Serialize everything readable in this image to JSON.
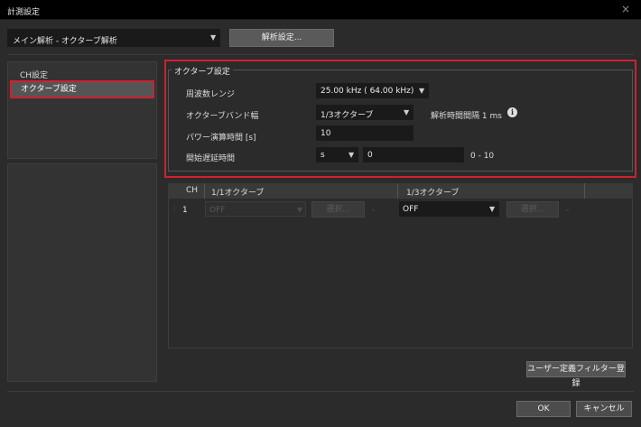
{
  "window": {
    "title": "計測設定",
    "close_glyph": "×"
  },
  "mode": {
    "selected": "メイン解析 - オクターブ解析",
    "analysis_button": "解析設定..."
  },
  "nav": {
    "items": [
      {
        "label": "CH設定"
      },
      {
        "label": "オクターブ設定"
      }
    ]
  },
  "octave_settings": {
    "title": "オクターブ設定",
    "frequency_range": {
      "label": "周波数レンジ",
      "value": "25.00 kHz ( 64.00 kHz)"
    },
    "band_width": {
      "label": "オクターブバンド幅",
      "value": "1/3オクターブ"
    },
    "analysis_interval": {
      "label": "解析時間間隔 1 ms"
    },
    "power_time": {
      "label": "パワー演算時間 [s]",
      "value": "10"
    },
    "start_delay": {
      "label": "開始遅延時間",
      "unit": "s",
      "value": "0",
      "range": "0 - 10"
    }
  },
  "table": {
    "headers": [
      "CH",
      "1/1オクターブ",
      "1/3オクターブ"
    ],
    "rows": [
      {
        "ch": "1",
        "octave_1_1": {
          "value": "OFF",
          "select_button": "選択...",
          "dash": "-"
        },
        "octave_1_3": {
          "value": "OFF",
          "select_button": "選択...",
          "dash": "-"
        }
      }
    ]
  },
  "footer": {
    "user_filter_button": "ユーザー定義フィルター登録",
    "ok_button": "OK",
    "cancel_button": "キャンセル"
  },
  "colors": {
    "highlight": "#d0202c",
    "background": "#2b2b2b",
    "titlebar": "#000000",
    "field": "#1a1a1a"
  },
  "icons": {
    "close": "close-icon",
    "dropdown": "chevron-down-icon",
    "info": "info-icon"
  }
}
